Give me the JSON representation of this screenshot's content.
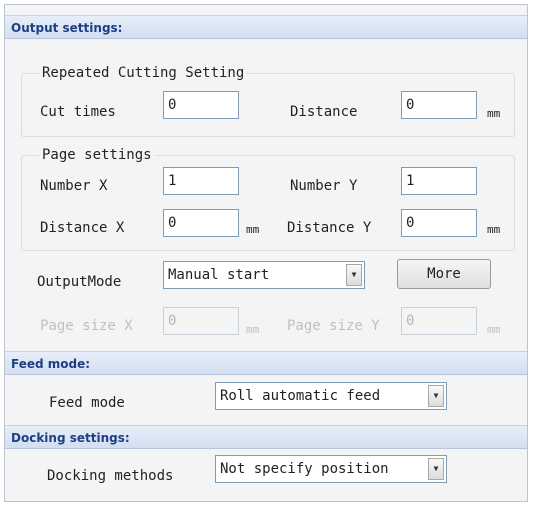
{
  "output_settings": {
    "header": "Output settings:",
    "repeated_cutting": {
      "title": "Repeated Cutting Setting",
      "cut_times_label": "Cut times",
      "cut_times_value": "0",
      "distance_label": "Distance",
      "distance_value": "0",
      "distance_unit": "mm"
    },
    "page_settings": {
      "title": "Page settings",
      "number_x_label": "Number X",
      "number_x_value": "1",
      "number_y_label": "Number Y",
      "number_y_value": "1",
      "distance_x_label": "Distance X",
      "distance_x_value": "0",
      "distance_x_unit": "mm",
      "distance_y_label": "Distance Y",
      "distance_y_value": "0",
      "distance_y_unit": "mm"
    },
    "output_mode_label": "OutputMode",
    "output_mode_value": "Manual start",
    "more_button": "More",
    "page_size_x_label": "Page size X",
    "page_size_x_value": "0",
    "page_size_x_unit": "mm",
    "page_size_y_label": "Page size Y",
    "page_size_y_value": "0",
    "page_size_y_unit": "mm"
  },
  "feed_mode": {
    "header": "Feed mode:",
    "label": "Feed mode",
    "value": "Roll automatic feed"
  },
  "docking_settings": {
    "header": "Docking settings:",
    "label": "Docking methods",
    "value": "Not specify position"
  },
  "icons": {
    "dropdown": "▼"
  }
}
